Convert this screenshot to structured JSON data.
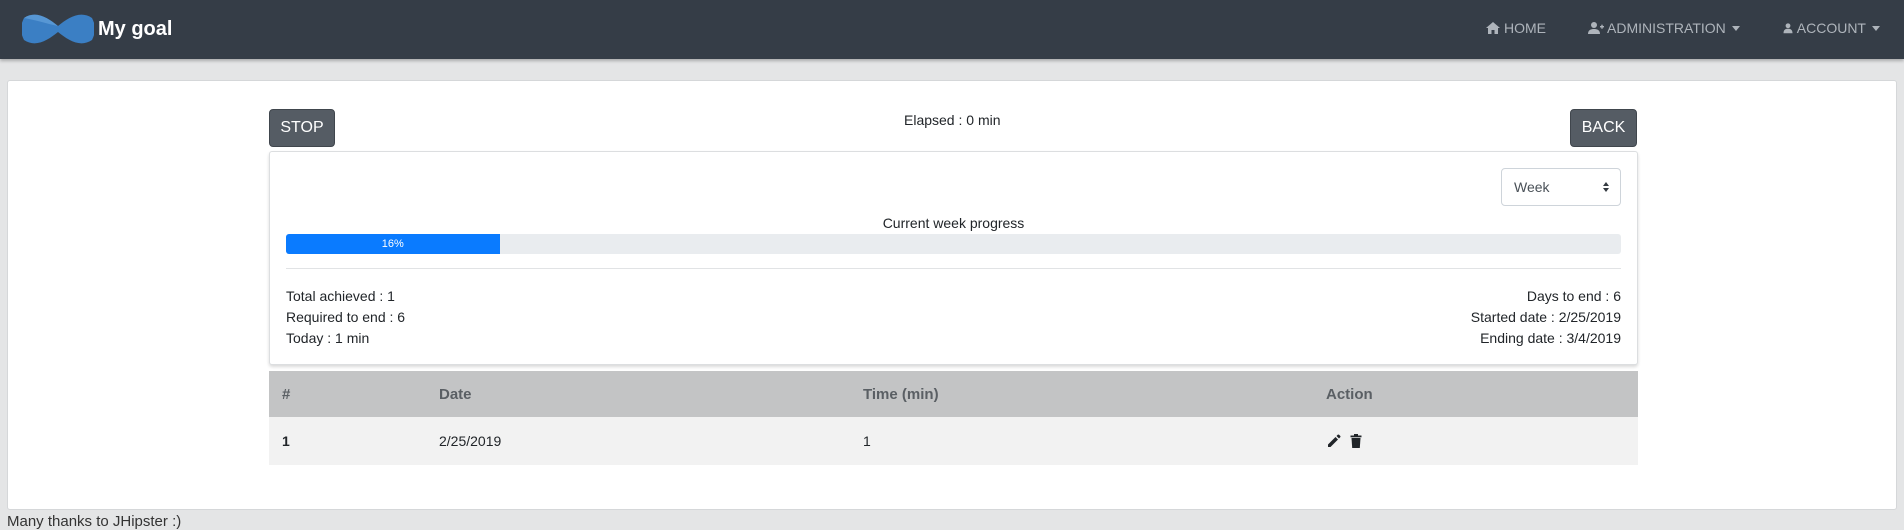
{
  "navbar": {
    "brand_title": "My goal",
    "brand_icon": "bowtie-logo",
    "items": [
      {
        "label": "HOME",
        "icon": "home-icon",
        "has_caret": false
      },
      {
        "label": "ADMINISTRATION",
        "icon": "user-plus-icon",
        "has_caret": true
      },
      {
        "label": "ACCOUNT",
        "icon": "user-icon",
        "has_caret": true
      }
    ]
  },
  "controls": {
    "stop_label": "STOP",
    "back_label": "BACK",
    "elapsed_text": "Elapsed : 0 min"
  },
  "progress": {
    "period_select_value": "Week",
    "label": "Current week progress",
    "percent": 16,
    "percent_text": "16%",
    "color": "#0a7bff"
  },
  "stats": {
    "total_achieved": "Total achieved : 1",
    "required_to_end": "Required to end : 6",
    "today": "Today : 1 min",
    "days_to_end": "Days to end : 6",
    "started_date": "Started date : 2/25/2019",
    "ending_date": "Ending date : 3/4/2019"
  },
  "table": {
    "headers": [
      "#",
      "Date",
      "Time (min)",
      "Action"
    ],
    "rows": [
      {
        "num": "1",
        "date": "2/25/2019",
        "time": "1",
        "actions": [
          "pencil-icon",
          "trash-icon"
        ]
      }
    ]
  },
  "footer": {
    "text": "Many thanks to JHipster :)"
  }
}
